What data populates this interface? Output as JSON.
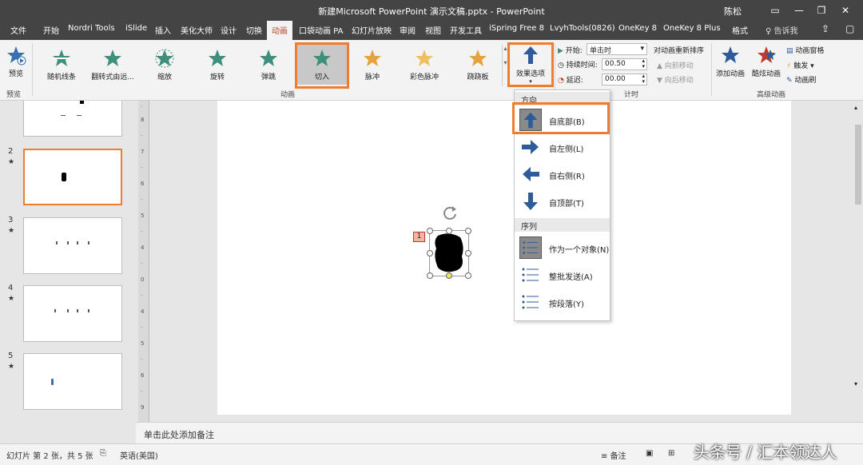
{
  "window": {
    "title": "新建Microsoft PowerPoint 演示文稿.pptx  -  PowerPoint",
    "user": "陈松",
    "minimize": "—",
    "restore": "❐",
    "close": "✕"
  },
  "tabs": [
    "文件",
    "开始",
    "Nordri Tools",
    "iSlide",
    "插入",
    "美化大师",
    "设计",
    "切换",
    "动画",
    "口袋动画 PA",
    "幻灯片放映",
    "审阅",
    "视图",
    "开发工具",
    "iSpring Free 8",
    "LvyhTools(0826)",
    "OneKey 8",
    "OneKey 8 Plus",
    "格式"
  ],
  "active_tab": "动画",
  "search_tab": "♀ 告诉我",
  "ribbon": {
    "preview_label": "预览",
    "preview_group": "预览",
    "animations": [
      "随机线条",
      "翻转式由远...",
      "缩放",
      "旋转",
      "弹跳",
      "切入",
      "脉冲",
      "彩色脉冲",
      "跷跷板"
    ],
    "animation_group": "动画",
    "effect_options": "效果选项",
    "timing": {
      "start_label": "开始:",
      "start_value": "单击时",
      "duration_label": "持续时间:",
      "duration_value": "00.50",
      "delay_label": "延迟:",
      "delay_value": "00.00",
      "group": "计时"
    },
    "reorder_title": "对动画重新排序",
    "move_earlier": "▲ 向前移动",
    "move_later": "▼ 向后移动",
    "add_animation": "添加动画",
    "animation_painter": "酷炫动画",
    "animation_pane": "动画窗格",
    "trigger": "触发",
    "anim_brush": "动画刷",
    "advanced_group": "高级动画"
  },
  "slides": [
    {
      "num": "",
      "star": ""
    },
    {
      "num": "2",
      "star": "★"
    },
    {
      "num": "3",
      "star": "★"
    },
    {
      "num": "4",
      "star": "★"
    },
    {
      "num": "5",
      "star": "★"
    }
  ],
  "dropdown": {
    "header_direction": "方向",
    "directions": [
      "自底部(B)",
      "自左侧(L)",
      "自右侧(R)",
      "自顶部(T)"
    ],
    "header_sequence": "序列",
    "sequences": [
      "作为一个对象(N)",
      "整批发送(A)",
      "按段落(Y)"
    ]
  },
  "anim_badge": "1",
  "notes": "单击此处添加备注",
  "status": {
    "slide_info": "幻灯片 第 2 张，共 5 张",
    "language": "英语(美国)",
    "notes_btn": "备注"
  },
  "watermark": "头条号 / 汇本领达人",
  "colors": {
    "accent": "#ed7d31",
    "titlebar": "#444444",
    "icon_teal": "#3e8f7c",
    "icon_gold": "#e6a23c",
    "arrow_blue": "#2e5c9a"
  }
}
